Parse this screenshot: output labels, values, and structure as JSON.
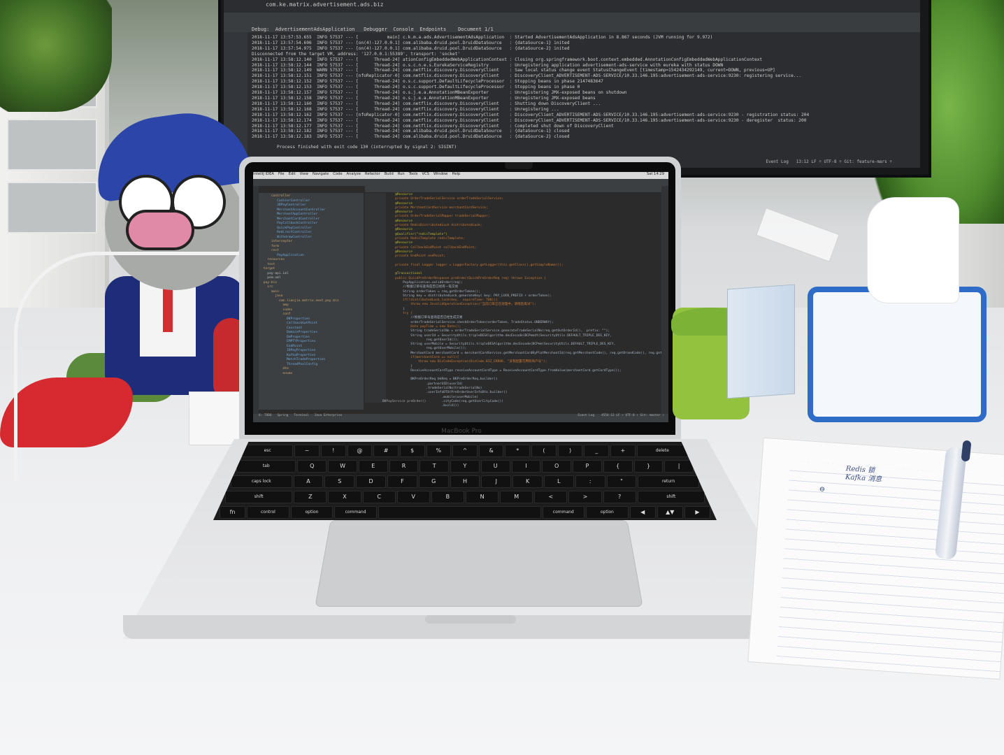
{
  "monitor": {
    "title": "com.ke.matrix.advertisement.ads.biz",
    "debug_label": "Debug:",
    "run_config": "AdvertisementAdsApplication",
    "debugger_tab": "Debugger",
    "console_tab": "Console",
    "endpoints_tab": "Endpoints",
    "document_label": "Document 1/1",
    "console_lines": [
      "2018-11-17 13:57:53.655  INFO 57537 --- [           main] c.k.m.a.ads.AdvertisementAdsApplication  : Started AdvertisementAdsApplication in 8.867 seconds (JVM running for 9.972)",
      "2018-11-17 13:57:54.696  INFO 57537 --- [on(4)-127.0.0.1] com.alibaba.druid.pool.DruidDataSource   : {dataSource-1} inited",
      "2018-11-17 13:57:54.975  INFO 57537 --- [on(4)-127.0.0.1] com.alibaba.druid.pool.DruidDataSource   : {dataSource-2} inited",
      "Disconnected from the target VM, address: '127.0.0.1:55389', transport: 'socket'",
      "2018-11-17 13:58:12.140  INFO 57537 --- [      Thread-24] ationConfigEmbeddedWebApplicationContext : Closing org.springframework.boot.context.embedded.AnnotationConfigEmbeddedWebApplicationContext",
      "2018-11-17 13:58:12.144  INFO 57537 --- [      Thread-24] o.s.c.n.e.s.EurekaServiceRegistry        : Unregistering application advertisement-ads-service with eureka with status DOWN",
      "2018-11-17 13:58:12.149  WARN 57537 --- [      Thread-24] com.netflix.discovery.DiscoveryClient    : Saw local status change event StatusChangeEvent [timestamp=1542434292149, current=DOWN, previous=UP]",
      "2018-11-17 13:58:12.151  INFO 57537 --- [nfoReplicator-0] com.netflix.discovery.DiscoveryClient    : DiscoveryClient_ADVERTISEMENT-ADS-SERVICE/10.33.146.195:advertisement-ads-service:9230: registering service...",
      "2018-11-17 13:58:12.152  INFO 57537 --- [      Thread-24] o.s.c.support.DefaultLifecycleProcessor  : Stopping beans in phase 2147483647",
      "2018-11-17 13:58:12.153  INFO 57537 --- [      Thread-24] o.s.c.support.DefaultLifecycleProcessor  : Stopping beans in phase 0",
      "2018-11-17 13:58:12.157  INFO 57537 --- [      Thread-24] o.s.j.e.a.AnnotationMBeanExporter        : Unregistering JMX-exposed beans on shutdown",
      "2018-11-17 13:58:12.158  INFO 57537 --- [      Thread-24] o.s.j.e.a.AnnotationMBeanExporter        : Unregistering JMX-exposed beans",
      "2018-11-17 13:58:12.160  INFO 57537 --- [      Thread-24] com.netflix.discovery.DiscoveryClient    : Shutting down DiscoveryClient ...",
      "2018-11-17 13:58:12.168  INFO 57537 --- [      Thread-24] com.netflix.discovery.DiscoveryClient    : Unregistering ...",
      "2018-11-17 13:58:12.162  INFO 57537 --- [nfoReplicator-0] com.netflix.discovery.DiscoveryClient    : DiscoveryClient_ADVERTISEMENT-ADS-SERVICE/10.33.146.195:advertisement-ads-service:9230 - registration status: 204",
      "2018-11-17 13:58:12.174  INFO 57537 --- [      Thread-24] com.netflix.discovery.DiscoveryClient    : DiscoveryClient_ADVERTISEMENT-ADS-SERVICE/10.33.146.195:advertisement-ads-service:9230 - deregister  status: 200",
      "2018-11-17 13:58:12.177  INFO 57537 --- [      Thread-24] com.netflix.discovery.DiscoveryClient    : Completed shut down of DiscoveryClient",
      "2018-11-17 13:58:12.182  INFO 57537 --- [      Thread-24] com.alibaba.druid.pool.DruidDataSource   : {dataSource-1} closed",
      "2018-11-17 13:58:12.183  INFO 57537 --- [      Thread-24] com.alibaba.druid.pool.DruidDataSource   : {dataSource-2} closed"
    ],
    "exit_line": "Process finished with exit code 130 (interrupted by signal 2: SIGINT)",
    "status": "13:12  LF ÷  UTF-8 ÷  Git: feature-mars ÷",
    "event_log": "Event Log"
  },
  "laptop": {
    "brand_label": "MacBook Pro",
    "menubar": [
      "IntelliJ IDEA",
      "File",
      "Edit",
      "View",
      "Navigate",
      "Code",
      "Analyze",
      "Refactor",
      "Build",
      "Run",
      "Tools",
      "VCS",
      "Window",
      "Help"
    ],
    "clock": "Sat 14:29",
    "tree": [
      {
        "text": "     controller",
        "kind": "dir"
      },
      {
        "text": "        CashierController",
        "kind": "cls"
      },
      {
        "text": "        JDPayController",
        "kind": "cls"
      },
      {
        "text": "        MerchantAccountController",
        "kind": "cls"
      },
      {
        "text": "        MerchantAppController",
        "kind": "cls"
      },
      {
        "text": "        MerchantCardController",
        "kind": "cls"
      },
      {
        "text": "        PayCallbackController",
        "kind": "cls"
      },
      {
        "text": "        QuickPayController",
        "kind": "cls"
      },
      {
        "text": "        RedirectController",
        "kind": "cls"
      },
      {
        "text": "        WithdrawController",
        "kind": "cls"
      },
      {
        "text": "     interceptor",
        "kind": "dir"
      },
      {
        "text": "     form",
        "kind": "dir"
      },
      {
        "text": "     rest",
        "kind": "dir"
      },
      {
        "text": "        PayApplication",
        "kind": "cls"
      },
      {
        "text": "   resources",
        "kind": "dir"
      },
      {
        "text": "   test",
        "kind": "dir"
      },
      {
        "text": " target",
        "kind": "dir"
      },
      {
        "text": "   pay-api.iml",
        "kind": "file"
      },
      {
        "text": "   pom.xml",
        "kind": "file"
      },
      {
        "text": " pay-biz",
        "kind": "dir"
      },
      {
        "text": "   src",
        "kind": "dir"
      },
      {
        "text": "     main",
        "kind": "dir"
      },
      {
        "text": "       java",
        "kind": "dir"
      },
      {
        "text": "         com.lianjia.matrix.next.pay.biz",
        "kind": "dir"
      },
      {
        "text": "           amp",
        "kind": "dir"
      },
      {
        "text": "           codec",
        "kind": "dir"
      },
      {
        "text": "           conf",
        "kind": "dir"
      },
      {
        "text": "             BKProperties",
        "kind": "cls"
      },
      {
        "text": "             CallbackGwtPoint",
        "kind": "cls"
      },
      {
        "text": "             Constant",
        "kind": "cls"
      },
      {
        "text": "             DomainProperties",
        "kind": "cls"
      },
      {
        "text": "             DmProperties",
        "kind": "cls"
      },
      {
        "text": "             EMPTYProperties",
        "kind": "cls"
      },
      {
        "text": "             EndPoint",
        "kind": "cls"
      },
      {
        "text": "             JDPayProperties",
        "kind": "cls"
      },
      {
        "text": "             KafkaProperties",
        "kind": "cls"
      },
      {
        "text": "             MatchTradeProperties",
        "kind": "cls"
      },
      {
        "text": "             ThreadPoolConfig",
        "kind": "cls"
      },
      {
        "text": "           dto",
        "kind": "dir"
      },
      {
        "text": "           enums",
        "kind": "dir"
      }
    ],
    "code_lines": [
      "    @Resource",
      "    private OrderTradeSerialService orderTradeSerialService;",
      "    @Resource",
      "    private MerchantCardService merchantCardService;",
      "    @Resource",
      "    private OrderTradeSerialMapper tradeSerialMapper;",
      "    @Resource",
      "    private RedisDistributedLock distributedLock;",
      "    @Resource",
      "    @Qualifier(\"redisTemplate\")",
      "    private RedisTemplate redisTemplate;",
      "    @Resource",
      "    private CallbackEndPoint callbackEndPoint;",
      "    @Resource",
      "    private EndPoint endPoint;",
      "",
      "    private final Logger logger = LoggerFactory.getLogger(this.getClass().getSimpleName());",
      "",
      "    @Transactional",
      "    public QuickPreOrderResponse preOrder(QuickPreOrderReq req) throws Exception {",
      "        PayApplication.validOrder(req);",
      "        //根据订单号查询是否已经有一笔交易",
      "        String orderToken = req.getOrderToken();",
      "        String key = distributedLock.generateKey( key: PAY_LOCK_PREFIX + orderToken);",
      "        if(!distributedLock.lock(key,  expireTime: 700)){",
      "            throw new InvalidOperationException(\"当前订单正在处理中，请稍后再试\");",
      "        }",
      "        try {",
      "            //根据订单号查询是否已经生成交易",
      "            orderTradeSerialService.checkOrderToken(orderToken, TradeStatus.UNDERWAY);",
      "            Date payTime = new Date();",
      "            String tradeSerialNo = orderTradeSerialService.generateTradeSerialNo(req.getOutOrderId(),  prefix: \"\");",
      "            String userId = SecurityUtils.tripleDESAlgorithm.decEncode(BCPemdt(SecurityUtils.DEFAULT_TRIPLE_DES_KEY,",
      "                    req.getUserId());",
      "            String userMobile = SecurityUtils.tripleDESAlgorithm.decEncode(BCPem(SecurityUtils.DEFAULT_TRIPLE_DES_KEY,",
      "                    req.getUserMobile());",
      "            MerchantCard merchantCard = merchantCardService.getMerchantCardByPlatMerchantId(req.getMerchantCode(), req.getBrandCode(), req.get",
      "            if(merchantCard == null){",
      "                throw new BizCodeException(BizCode.BIZ_ERROR, \"没有配置可用的商户号\");",
      "            }",
      "            ReceiveAccountCardType receiveAccountCardType = ReceiveAccountCardType.fromValue(merchantCard.getCardType());",
      "",
      "            BKPreOrderReq bkReq = BKPreOrderReq.builder()",
      "                    .partnerUID(userId)",
      "                    .tradeSerialNo(tradeSerialNo)",
      "                    .userInfoDTO(PreOrderUserInfoDto.builder()",
      "                            .mobile(userMobile)",
      "                            .cityCode(req.getUserCityCode())",
      "                            .build())"
    ],
    "bottom_tab": "BKPayService     preOrder()",
    "status": "4554:12  LF ÷  UTF-8 ÷  Git: master ÷",
    "status_tabs": [
      "6: TODO",
      "Spring",
      "Terminal",
      "Java Enterprise"
    ],
    "event_log": "Event Log"
  },
  "keyboard": {
    "rows": [
      [
        "esc",
        "~",
        "!",
        "@",
        "#",
        "$",
        "%",
        "^",
        "&",
        "*",
        "(",
        ")",
        "_",
        "+",
        "delete"
      ],
      [
        "tab",
        "Q",
        "W",
        "E",
        "R",
        "T",
        "Y",
        "U",
        "I",
        "O",
        "P",
        "{",
        "}",
        "|"
      ],
      [
        "caps lock",
        "A",
        "S",
        "D",
        "F",
        "G",
        "H",
        "J",
        "K",
        "L",
        ":",
        "\"",
        "return"
      ],
      [
        "shift",
        "Z",
        "X",
        "C",
        "V",
        "B",
        "N",
        "M",
        "<",
        ">",
        "?",
        "shift"
      ],
      [
        "fn",
        "control",
        "option",
        "command",
        "",
        "command",
        "option",
        "◀",
        "▲▼",
        "▶"
      ]
    ]
  },
  "notebook": {
    "line1": "Redis 锁",
    "line2": "Kafka 消息",
    "mark": "⊖"
  }
}
